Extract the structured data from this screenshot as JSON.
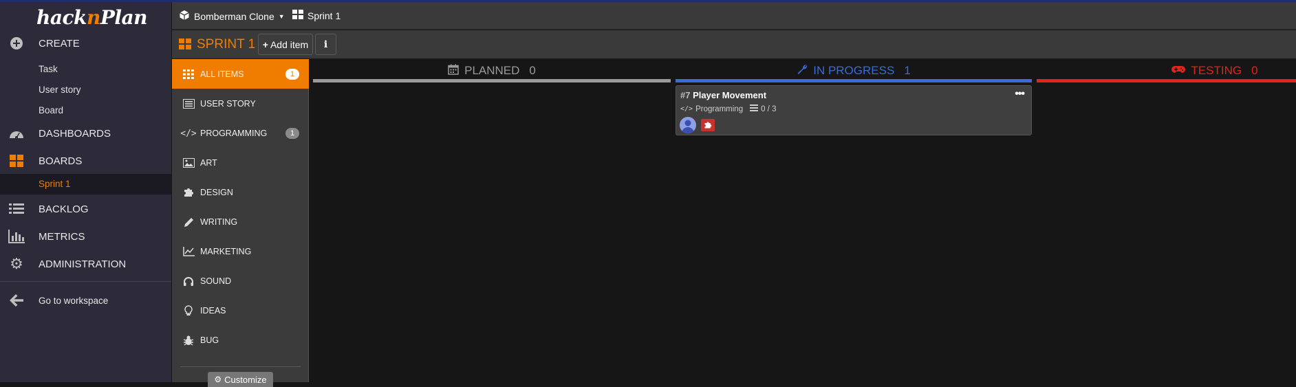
{
  "app": {
    "logo_prefix": "hack",
    "logo_n": "n",
    "logo_suffix": "Plan"
  },
  "sidebar": {
    "create": "CREATE",
    "create_items": [
      "Task",
      "User story",
      "Board"
    ],
    "dashboards": "DASHBOARDS",
    "boards": "BOARDS",
    "active_board": "Sprint 1",
    "backlog": "BACKLOG",
    "metrics": "METRICS",
    "administration": "ADMINISTRATION",
    "go_workspace": "Go to workspace"
  },
  "topbar": {
    "project": "Bomberman Clone",
    "sprint": "Sprint 1"
  },
  "subbar": {
    "title": "SPRINT 1",
    "add_item": "Add item",
    "info": "i"
  },
  "categories": [
    {
      "label": "ALL ITEMS",
      "count": "1",
      "icon": "grid-icon"
    },
    {
      "label": "USER STORY",
      "count": "",
      "icon": "list-icon"
    },
    {
      "label": "PROGRAMMING",
      "count": "1",
      "icon": "code-icon"
    },
    {
      "label": "ART",
      "count": "",
      "icon": "image-icon"
    },
    {
      "label": "DESIGN",
      "count": "",
      "icon": "puzzle-icon"
    },
    {
      "label": "WRITING",
      "count": "",
      "icon": "pencil-icon"
    },
    {
      "label": "MARKETING",
      "count": "",
      "icon": "chart-line-icon"
    },
    {
      "label": "SOUND",
      "count": "",
      "icon": "headphones-icon"
    },
    {
      "label": "IDEAS",
      "count": "",
      "icon": "lightbulb-icon"
    },
    {
      "label": "BUG",
      "count": "",
      "icon": "bug-icon"
    }
  ],
  "customize": "Customize",
  "columns": [
    {
      "label": "PLANNED",
      "count": "0",
      "color": "#9a9a9a"
    },
    {
      "label": "IN PROGRESS",
      "count": "1",
      "color": "#3a6bd6"
    },
    {
      "label": "TESTING",
      "count": "0",
      "color": "#e0251b"
    }
  ],
  "card": {
    "number": "#7",
    "title": "Player Movement",
    "category": "Programming",
    "subtasks": "0 / 3"
  },
  "colors": {
    "accent": "#f07d00",
    "sidebar": "#2d2a3a"
  }
}
